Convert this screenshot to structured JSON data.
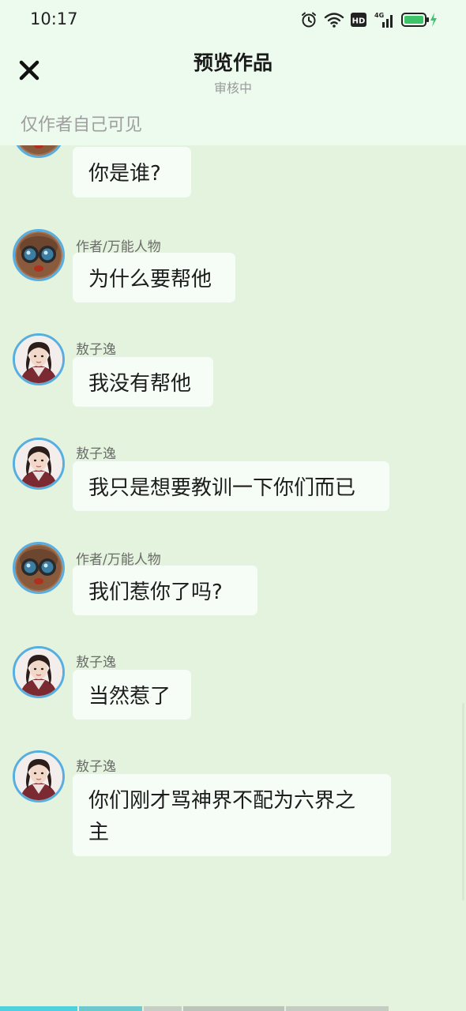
{
  "status_bar": {
    "time": "10:17",
    "network": "4G",
    "hd": "HD"
  },
  "header": {
    "title": "预览作品",
    "subtitle": "审核中",
    "visibility_note": "仅作者自己可见"
  },
  "messages": [
    {
      "speaker": "",
      "avatar": "goggles",
      "text": "你是谁?"
    },
    {
      "speaker": "作者/万能人物",
      "avatar": "goggles",
      "text": "为什么要帮他"
    },
    {
      "speaker": "敖子逸",
      "avatar": "young-man",
      "text": "我没有帮他"
    },
    {
      "speaker": "敖子逸",
      "avatar": "young-man",
      "text": "我只是想要教训一下你们而已"
    },
    {
      "speaker": "作者/万能人物",
      "avatar": "goggles",
      "text": "我们惹你了吗?"
    },
    {
      "speaker": "敖子逸",
      "avatar": "young-man",
      "text": "当然惹了"
    },
    {
      "speaker": "敖子逸",
      "avatar": "young-man",
      "text": "你们刚才骂神界不配为六界之主"
    }
  ],
  "colors": {
    "background": "#e4f3dd",
    "header_bg": "#edfaee",
    "bubble_bg": "#f6fdf6",
    "avatar_ring": "#57aee0",
    "battery": "#3dc46a"
  }
}
